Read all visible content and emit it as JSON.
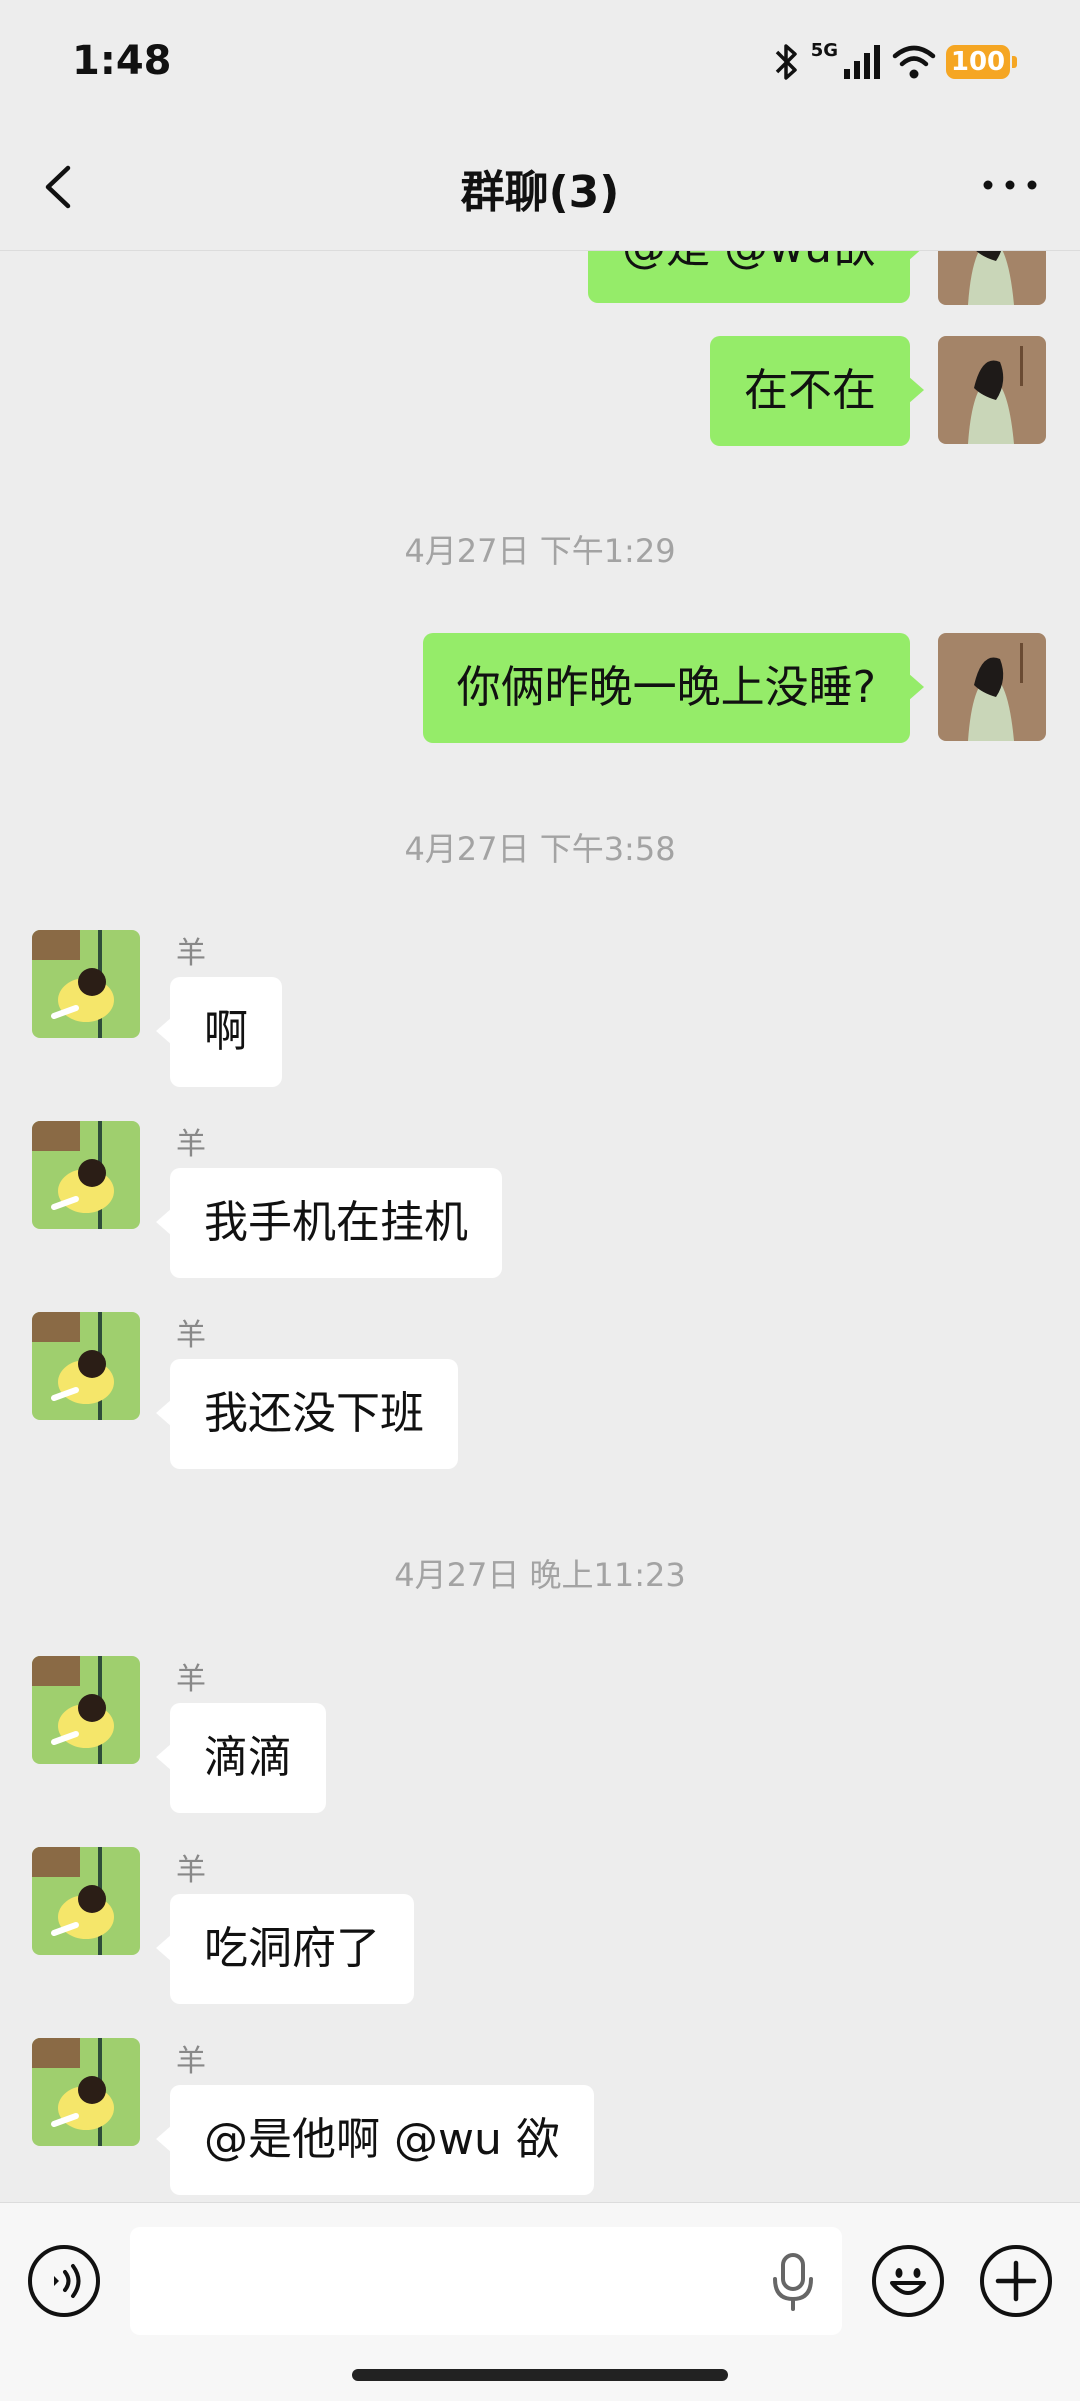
{
  "status_bar": {
    "time": "1:48",
    "network": "5G",
    "battery": "100"
  },
  "nav": {
    "title": "群聊(3)"
  },
  "messages": [
    {
      "type": "outgoing",
      "text": "@是 @wu欲"
    },
    {
      "type": "outgoing",
      "text": "在不在"
    },
    {
      "type": "time",
      "text": "4月27日 下午1:29"
    },
    {
      "type": "outgoing",
      "text": "你俩昨晚一晚上没睡?"
    },
    {
      "type": "time",
      "text": "4月27日 下午3:58"
    },
    {
      "type": "incoming",
      "sender": "羊",
      "text": "啊"
    },
    {
      "type": "incoming",
      "sender": "羊",
      "text": "我手机在挂机"
    },
    {
      "type": "incoming",
      "sender": "羊",
      "text": "我还没下班"
    },
    {
      "type": "time",
      "text": "4月27日 晚上11:23"
    },
    {
      "type": "incoming",
      "sender": "羊",
      "text": "滴滴"
    },
    {
      "type": "incoming",
      "sender": "羊",
      "text": "吃洞府了"
    },
    {
      "type": "incoming",
      "sender": "羊",
      "text": "@是他啊 @wu 欲"
    }
  ],
  "input": {
    "placeholder": "",
    "value": ""
  },
  "colors": {
    "outgoing_bubble": "#95ec69",
    "incoming_bubble": "#ffffff",
    "background": "#ededed"
  },
  "icons": {
    "back": "chevron-left-icon",
    "more": "more-dots-icon",
    "voice": "voice-icon",
    "mic": "microphone-icon",
    "emoji": "emoji-icon",
    "plus": "plus-icon"
  }
}
